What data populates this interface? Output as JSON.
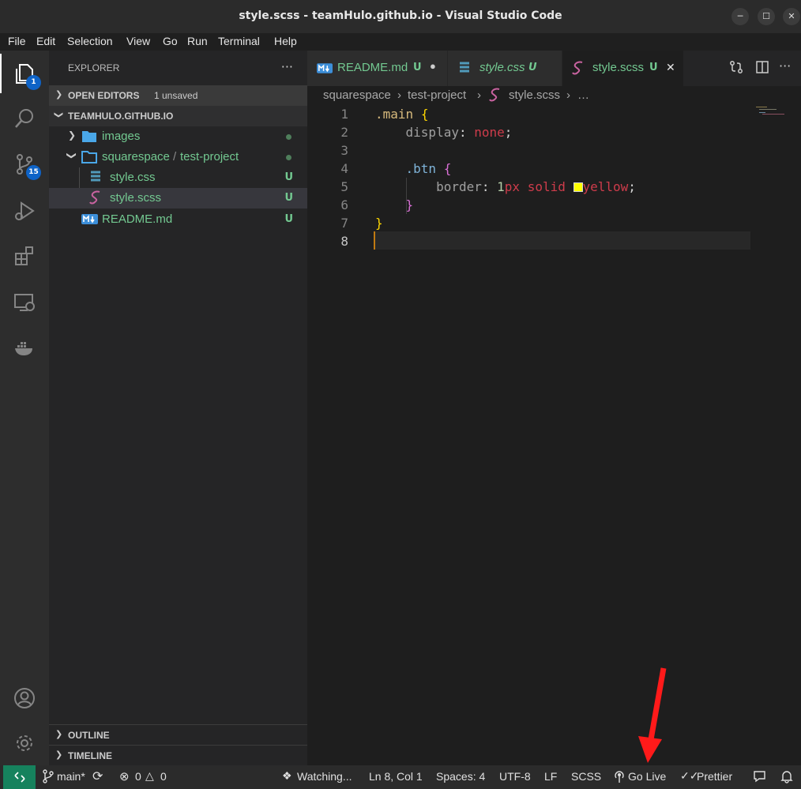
{
  "window": {
    "title": "style.scss - teamHulo.github.io - Visual Studio Code",
    "minimize_glyph": "─",
    "maximize_glyph": "☐",
    "close_glyph": "✕"
  },
  "menu": [
    "File",
    "Edit",
    "Selection",
    "View",
    "Go",
    "Run",
    "Terminal",
    "Help"
  ],
  "activity_bar": {
    "explorer_badge": "1",
    "scm_badge": "15",
    "icons": [
      "files-icon",
      "search-icon",
      "source-control-icon",
      "run-debug-icon",
      "extensions-icon",
      "remote-explorer-icon",
      "docker-icon",
      "account-icon",
      "settings-gear-icon"
    ]
  },
  "sidebar": {
    "title": "EXPLORER",
    "more": "···",
    "open_editors": {
      "label": "OPEN EDITORS",
      "extra": "1 unsaved"
    },
    "workspace": {
      "label": "TEAMHULO.GITHUB.IO"
    },
    "tree": [
      {
        "name": "images"
      },
      {
        "name": "squarespace",
        "sep": "/",
        "sub": "test-project"
      },
      {
        "name": "style.css",
        "status": "U"
      },
      {
        "name": "style.scss",
        "status": "U"
      },
      {
        "name": "README.md",
        "status": "U"
      }
    ],
    "outline": "OUTLINE",
    "timeline": "TIMELINE"
  },
  "tabs": [
    {
      "label": "README.md",
      "status": "U",
      "dirty_glyph": "●"
    },
    {
      "label": "style.css",
      "status": "U"
    },
    {
      "label": "style.scss",
      "status": "U",
      "close_glyph": "✕"
    }
  ],
  "tab_actions": {
    "more": "···"
  },
  "breadcrumb": [
    "squarespace",
    "test-project",
    "style.scss",
    "…"
  ],
  "breadcrumb_sep": "›",
  "editor": {
    "line_numbers": [
      "1",
      "2",
      "3",
      "4",
      "5",
      "6",
      "7",
      "8"
    ],
    "tokens": {
      "l1_sel": ".main",
      "l1_brace": "{",
      "l2_prop": "display",
      "l2_colon": ":",
      "l2_val": "none",
      "l2_semi": ";",
      "l4_sel": ".btn",
      "l4_brace": "{",
      "l5_prop": "border",
      "l5_colon": ":",
      "l5_num": "1",
      "l5_unit": "px",
      "l5_solid": "solid",
      "l5_color": "yellow",
      "l5_semi": ";",
      "l6_brace": "}",
      "l7_brace": "}"
    },
    "swatch_color": "#ffff00"
  },
  "statusbar": {
    "branch": "main*",
    "errors": "0",
    "warnings": "0",
    "watching": "Watching...",
    "position": "Ln 8, Col 1",
    "spaces": "Spaces: 4",
    "encoding": "UTF-8",
    "eol": "LF",
    "language": "SCSS",
    "golive": "Go Live",
    "prettier": "Prettier"
  },
  "colors": {
    "accent_green": "#73c991",
    "remote_bg": "#16825d",
    "badge_blue": "#0e63c7",
    "annotation_arrow": "#ff1a1a"
  }
}
